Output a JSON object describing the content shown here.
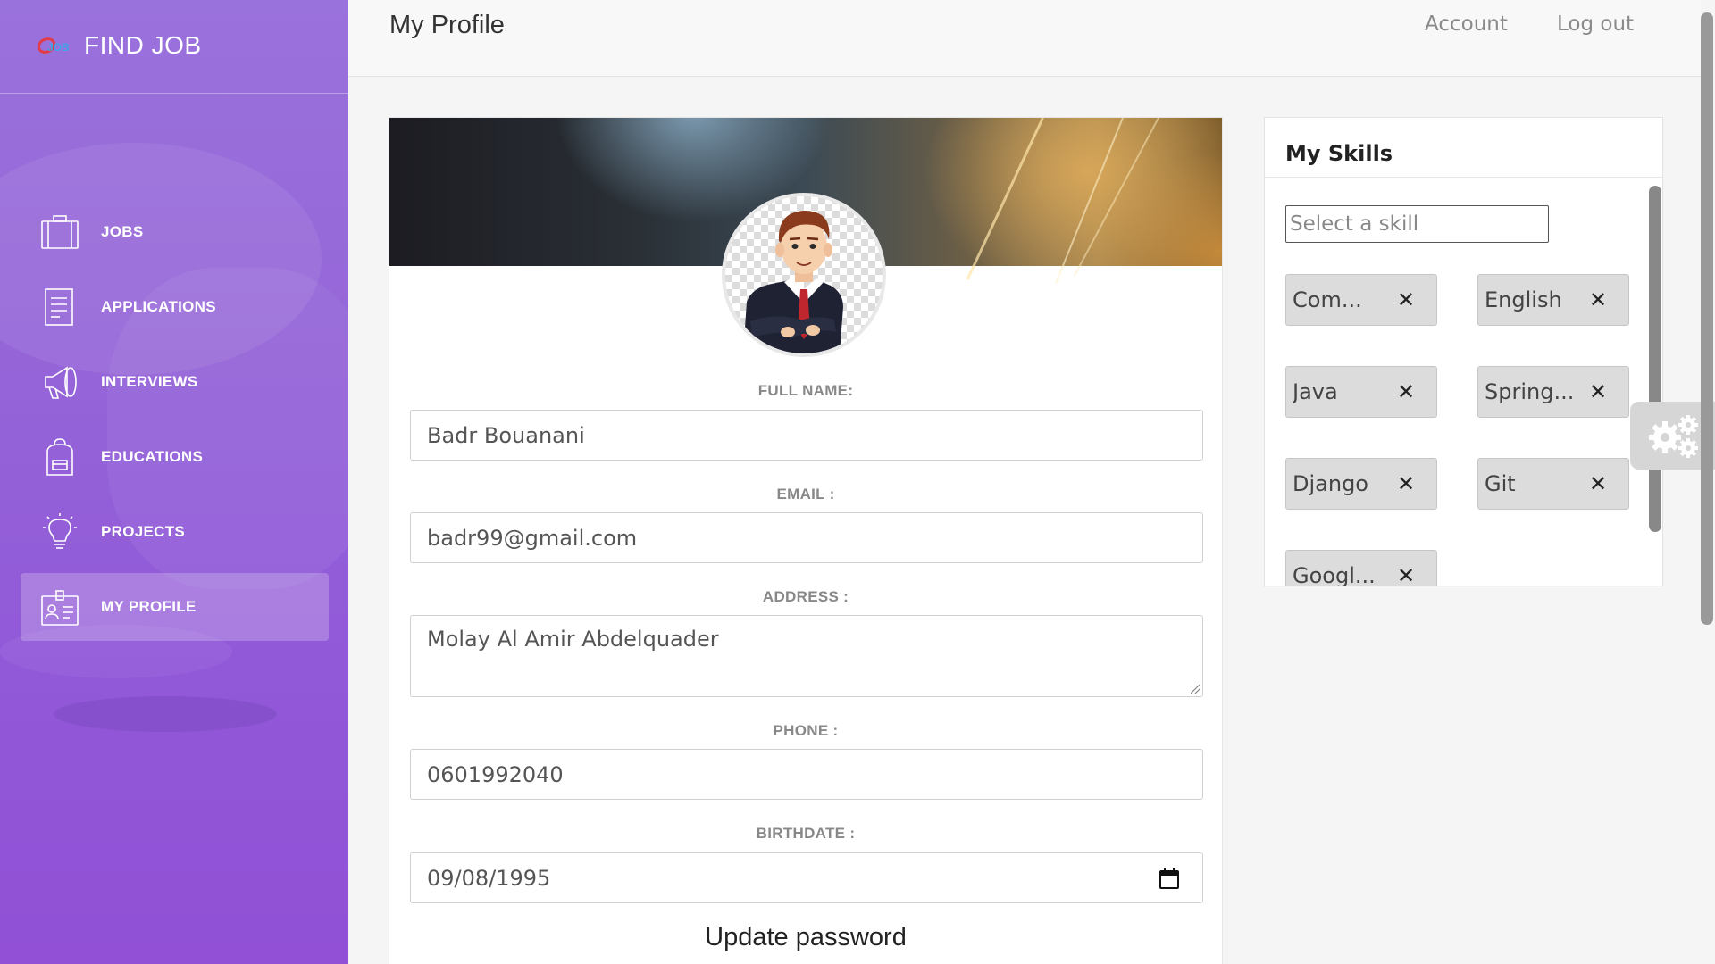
{
  "app": {
    "brand_name": "FIND JOB",
    "logo_text": "JOB"
  },
  "sidebar": {
    "items": [
      {
        "label": "JOBS",
        "icon": "briefcase-icon"
      },
      {
        "label": "APPLICATIONS",
        "icon": "document-icon"
      },
      {
        "label": "INTERVIEWS",
        "icon": "megaphone-icon"
      },
      {
        "label": "EDUCATIONS",
        "icon": "backpack-icon"
      },
      {
        "label": "PROJECTS",
        "icon": "lightbulb-icon"
      },
      {
        "label": "MY PROFILE",
        "icon": "id-card-icon",
        "active": true
      }
    ]
  },
  "header": {
    "title": "My Profile",
    "account_link": "Account",
    "logout_link": "Log out"
  },
  "profile": {
    "full_name_label": "FULL NAME:",
    "full_name": "Badr Bouanani",
    "email_label": "EMAIL :",
    "email": "badr99@gmail.com",
    "address_label": "ADDRESS :",
    "address": "Molay Al Amir Abdelquader",
    "phone_label": "PHONE :",
    "phone": "0601992040",
    "birthdate_label": "BIRTHDATE :",
    "birthdate": "09/08/1995",
    "update_password": "Update password"
  },
  "skills": {
    "title": "My Skills",
    "select_placeholder": "Select a skill",
    "items": [
      "Com...",
      "English",
      "Java",
      "Spring...",
      "Django",
      "Git",
      "Googl..."
    ]
  },
  "colors": {
    "sidebar_purple": "#9566d8",
    "chip_gray": "#dcdcdc"
  }
}
